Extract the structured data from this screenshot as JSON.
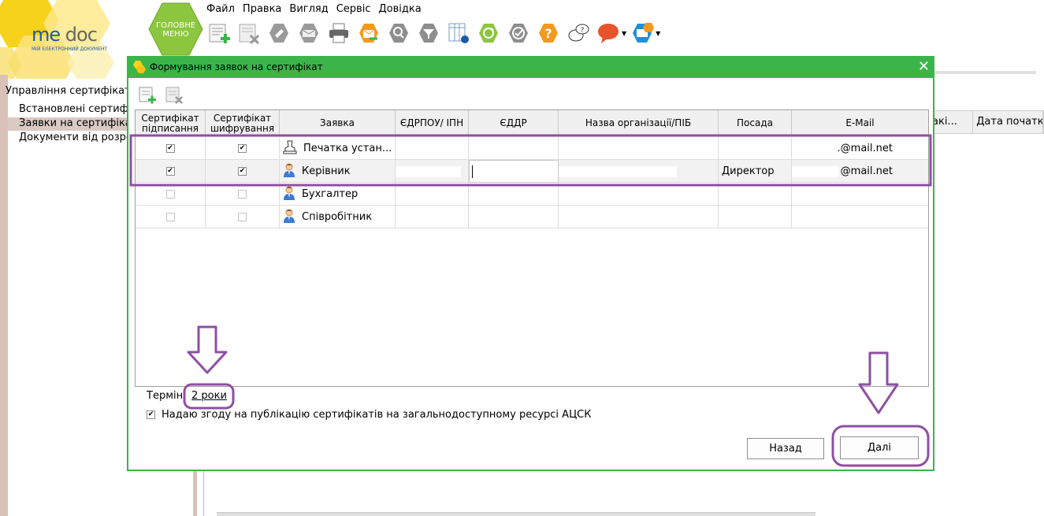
{
  "app": {
    "logo_word_a": "me",
    "logo_word_b": "doc",
    "logo_tagline": "МІЙ ЕЛЕКТРОННИЙ ДОКУМЕНТ",
    "main_menu_line1": "ГОЛОВНЕ",
    "main_menu_line2": "МЕНЮ"
  },
  "menubar": [
    "Файл",
    "Правка",
    "Вигляд",
    "Сервіс",
    "Довідка"
  ],
  "toolbar_icons": [
    "new-document-icon",
    "delete-document-icon",
    "sign-icon",
    "send-icon",
    "print-icon",
    "export-icon",
    "search-icon",
    "filter-icon",
    "table-settings-icon",
    "refresh-icon",
    "check-icon",
    "help-icon",
    "chat-question-icon",
    "feedback-icon",
    "video-help-icon"
  ],
  "left_nav": {
    "title": "Управління сертифікат",
    "items": [
      "Встановлені сертифік",
      "Заявки на сертифікат",
      "Документи від розроб"
    ]
  },
  "background_grid_headers": [
    "акі...",
    "Дата початку"
  ],
  "dialog": {
    "title": "Формування заявок на сертифікат",
    "close_glyph": "✕",
    "columns": [
      "Сертифікат підписання",
      "Сертифікат шифрування",
      "Заявка",
      "ЄДРПОУ/ ІПН",
      "ЄДДР",
      "Назва організації/ПІБ",
      "Посада",
      "E-Mail"
    ],
    "rows": [
      {
        "sign": true,
        "encrypt": true,
        "request": "Печатка устан...",
        "icon": "stamp-icon",
        "position": "",
        "email": ".@mail.net"
      },
      {
        "sign": true,
        "encrypt": true,
        "request": "Керівник",
        "icon": "person-icon",
        "position": "Директор",
        "email": "@mail.net"
      },
      {
        "sign": false,
        "encrypt": false,
        "request": "Бухгалтер",
        "icon": "person-icon",
        "position": "",
        "email": ""
      },
      {
        "sign": false,
        "encrypt": false,
        "request": "Співробітник",
        "icon": "person-icon",
        "position": "",
        "email": ""
      }
    ],
    "term_label": "Термін:",
    "term_value": "2 роки",
    "consent_checked": true,
    "consent_text": "Надаю згоду на публікацію сертифікатів на загальнодоступному ресурсі АЦСК",
    "back_button": "Назад",
    "next_button": "Далі"
  },
  "colors": {
    "accent_green": "#3bb54a",
    "annotation_purple": "#8e4fa3",
    "logo_yellow": "#f6d21a",
    "logo_blue": "#1e5aa8",
    "help_orange": "#f39a1e",
    "feedback_red": "#e8532b"
  }
}
